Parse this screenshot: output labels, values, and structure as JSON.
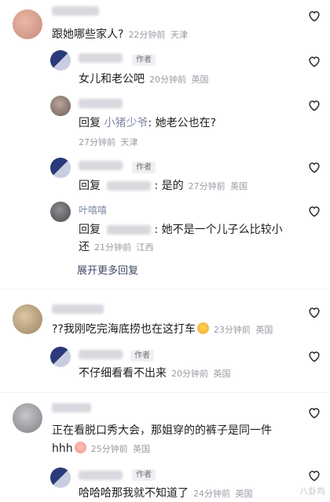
{
  "comments": [
    {
      "id": "c1",
      "text": "跟她哪些家人?",
      "time": "22分钟前",
      "location": "天津"
    },
    {
      "id": "r1",
      "tag": "作者",
      "text": "女儿和老公吧",
      "time": "20分钟前",
      "location": "英国"
    },
    {
      "id": "r2",
      "reply_word": "回复",
      "mention": "小猪少爷",
      "text": ": 她老公也在?",
      "time": "27分钟前",
      "location": "天津"
    },
    {
      "id": "r3",
      "tag": "作者",
      "reply_word": "回复",
      "text": ": 是的",
      "time": "27分钟前",
      "location": "英国"
    },
    {
      "id": "r4",
      "name": "叶嘻嘻",
      "reply_word": "回复",
      "text": ": 她不是一个儿子么比较小",
      "text2": "还",
      "time": "21分钟前",
      "location": "江西"
    },
    {
      "id": "c2",
      "text": "??我刚吃完海底捞也在这打车",
      "time": "23分钟前",
      "location": "英国"
    },
    {
      "id": "r5",
      "tag": "作者",
      "text": "不仔细看看不出来",
      "time": "20分钟前",
      "location": "英国"
    },
    {
      "id": "c3",
      "text": "正在看脱口秀大会，那姐穿的的裤子是同一件",
      "text2": "hhh",
      "time": "25分钟前",
      "location": "英国"
    },
    {
      "id": "r6",
      "tag": "作者",
      "text": "哈哈哈那我就不知道了",
      "time": "24分钟前",
      "location": "英国"
    }
  ],
  "expand_more": "展开更多回复",
  "watermark": "八卦鸡",
  "colors": {
    "accent": "#7d8aa5",
    "meta": "#9a9aa4",
    "heart": "#2b2b2b"
  },
  "icons": {
    "like": "heart-outline-icon",
    "avatar": "avatar"
  }
}
